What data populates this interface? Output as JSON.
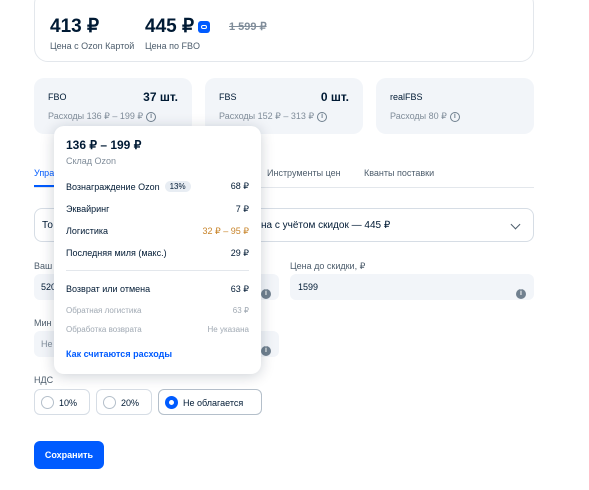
{
  "price_card": {
    "ozon_card_price": "413 ₽",
    "ozon_card_label": "Цена с Ozon Картой",
    "fbo_price": "445 ₽",
    "fbo_label": "Цена по FBO",
    "old_price": "1 599 ₽",
    "ozon_badge_icon": "ozon-card-icon"
  },
  "warehouses": [
    {
      "name": "FBO",
      "quantity": "37 шт.",
      "expenses": "Расходы 136 ₽ – 199 ₽"
    },
    {
      "name": "FBS",
      "quantity": "0 шт.",
      "expenses": "Расходы 152 ₽ – 313 ₽"
    },
    {
      "name": "realFBS",
      "quantity": "",
      "expenses": "Расходы 80 ₽"
    }
  ],
  "tabs": {
    "items": [
      "Упра",
      "Инструменты цен",
      "Кванты поставки"
    ]
  },
  "select": {
    "left_text": "То",
    "value": "на с учётом скидок — 445 ₽"
  },
  "fields": {
    "your_price_label": "Ваш",
    "your_price_value": "520",
    "price_before_discount_label": "Цена до скидки, ₽",
    "price_before_discount_value": "1599",
    "min_price_label": "Мин",
    "min_price_value": "Не"
  },
  "vat": {
    "label": "НДС",
    "options": [
      "10%",
      "20%",
      "Не облагается"
    ],
    "selected": "Не облагается"
  },
  "save_label": "Сохранить",
  "popover": {
    "title": "136 ₽ – 199 ₽",
    "subtitle": "Склад Ozon",
    "rows": [
      {
        "label": "Вознаграждение Ozon",
        "badge": "13%",
        "value": "68 ₽"
      },
      {
        "label": "Эквайринг",
        "value": "7 ₽"
      },
      {
        "label": "Логистика",
        "value": "32 ₽ – 95 ₽"
      },
      {
        "label": "Последняя миля (макс.)",
        "value": "29 ₽"
      },
      {
        "label": "Возврат или отмена",
        "value": "63 ₽"
      },
      {
        "label": "Обратная логистика",
        "value": "63 ₽"
      },
      {
        "label": "Обработка возврата",
        "value": "Не указана"
      }
    ],
    "link": "Как считаются расходы"
  },
  "colors": {
    "accent": "#005bff",
    "logistics_value": "#c8842a",
    "card_bg": "#f2f5f9"
  }
}
